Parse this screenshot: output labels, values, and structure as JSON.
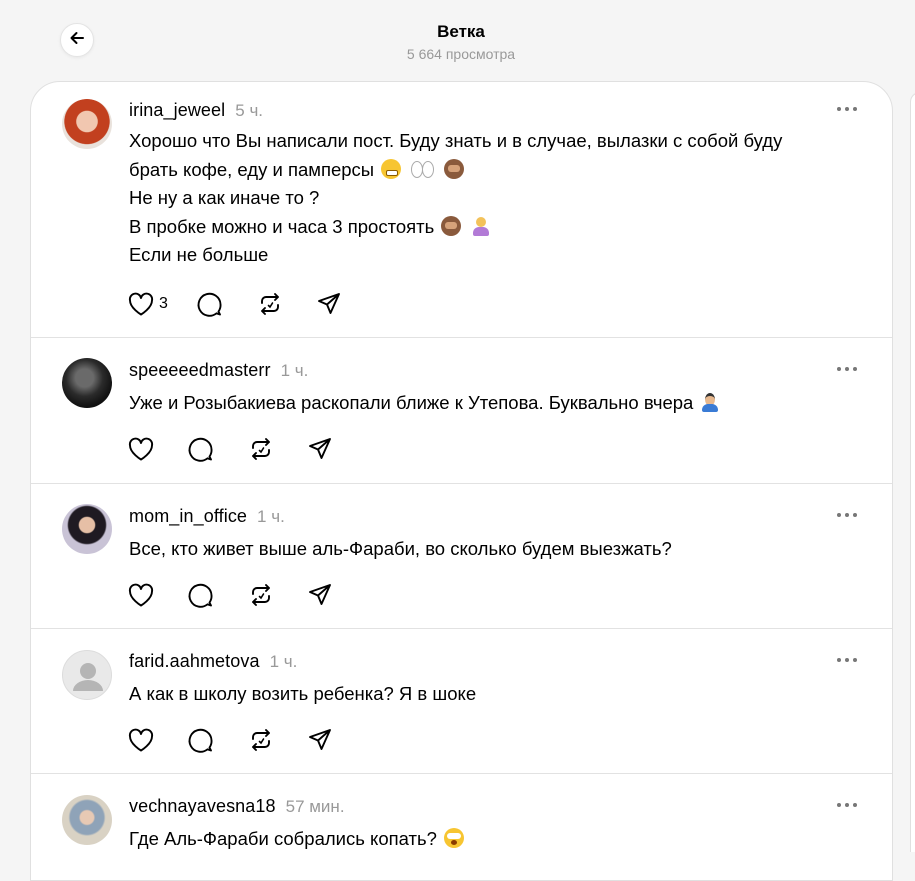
{
  "header": {
    "title": "Ветка",
    "views": "5 664 просмотра"
  },
  "icons": {
    "back": "arrow-left-icon",
    "like": "heart-icon",
    "reply": "comment-icon",
    "repost": "repost-icon",
    "share": "send-icon",
    "more": "more-dots-icon"
  },
  "posts": [
    {
      "username": "irina_jeweel",
      "time": "5 ч.",
      "lines": [
        "Хорошо что Вы написали пост. Буду знать и в случае, вылазки с собой буду",
        "брать кофе, еду и памперсы",
        "Не ну а как иначе то ?",
        "В пробке можно и часа 3 простоять",
        "Если не больше"
      ],
      "likes": "3"
    },
    {
      "username": "speeeeedmasterr",
      "time": "1 ч.",
      "lines": [
        "Уже и Розыбакиева раскопали ближе к Утепова. Буквально вчера"
      ],
      "likes": ""
    },
    {
      "username": "mom_in_office",
      "time": "1 ч.",
      "lines": [
        "Все, кто живет выше аль-Фараби, во сколько будем выезжать?"
      ],
      "likes": ""
    },
    {
      "username": "farid.aahmetova",
      "time": "1 ч.",
      "lines": [
        "А как в школу возить ребенка? Я в шоке"
      ],
      "likes": ""
    },
    {
      "username": "vechnayavesna18",
      "time": "57 мин.",
      "lines": [
        "Где Аль-Фараби собрались копать?"
      ],
      "likes": ""
    }
  ]
}
